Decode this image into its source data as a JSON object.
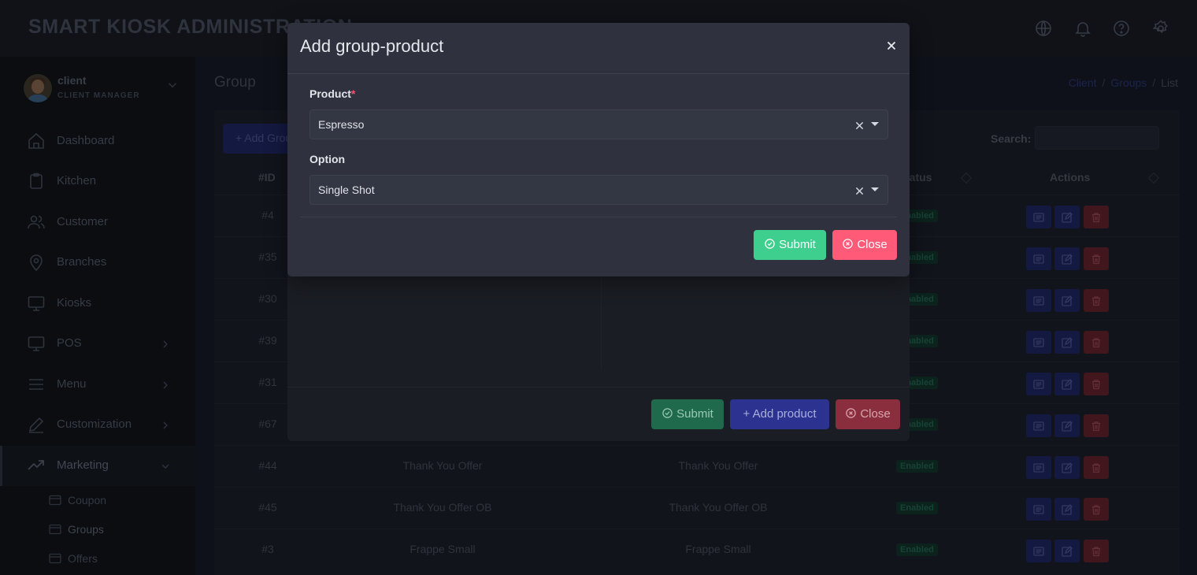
{
  "app": {
    "title": "SMART KIOSK ADMINISTRATION"
  },
  "header_icons": [
    "globe-icon",
    "bell-icon",
    "help-icon",
    "gear-icon"
  ],
  "user": {
    "name": "client",
    "role": "CLIENT MANAGER"
  },
  "sidebar": {
    "items": [
      {
        "label": "Dashboard",
        "icon": "home-icon"
      },
      {
        "label": "Kitchen",
        "icon": "clipboard-icon"
      },
      {
        "label": "Customer",
        "icon": "users-icon"
      },
      {
        "label": "Branches",
        "icon": "map-pin-icon"
      },
      {
        "label": "Kiosks",
        "icon": "monitor-icon"
      },
      {
        "label": "POS",
        "icon": "monitor-icon"
      },
      {
        "label": "Menu",
        "icon": "menu-icon"
      },
      {
        "label": "Customization",
        "icon": "pen-icon"
      },
      {
        "label": "Marketing",
        "icon": "trending-up-icon"
      }
    ],
    "marketing_sub": [
      "Coupon",
      "Groups",
      "Offers"
    ]
  },
  "page": {
    "title": "Group",
    "breadcrumb": [
      "Client",
      "Groups",
      "List"
    ],
    "add_button": "Add Group",
    "search_label": "Search:"
  },
  "table": {
    "columns": [
      "#ID",
      "Status",
      "Actions"
    ],
    "status_column_partial": "tatus",
    "rows": [
      {
        "id": "#4",
        "name": "",
        "name2": "",
        "status": "Enabled"
      },
      {
        "id": "#35",
        "name": "",
        "name2": "",
        "status": "Enabled"
      },
      {
        "id": "#30",
        "name": "",
        "name2": "",
        "status": "Enabled"
      },
      {
        "id": "#39",
        "name": "",
        "name2": "",
        "status": "Enabled"
      },
      {
        "id": "#31",
        "name": "",
        "name2": "",
        "status": "Enabled"
      },
      {
        "id": "#67",
        "name": "",
        "name2": "",
        "status": "Enabled"
      },
      {
        "id": "#44",
        "name": "Thank You Offer",
        "name2": "Thank You Offer",
        "status": "Enabled"
      },
      {
        "id": "#45",
        "name": "Thank You Offer OB",
        "name2": "Thank You Offer OB",
        "status": "Enabled"
      },
      {
        "id": "#3",
        "name": "Frappe Small",
        "name2": "Frappe Small",
        "status": "Enabled"
      }
    ]
  },
  "modal_back": {
    "submit": "Submit",
    "add_product": "Add product",
    "close": "Close"
  },
  "modal": {
    "title": "Add group-product",
    "product_label": "Product",
    "required_mark": "*",
    "product_value": "Espresso",
    "option_label": "Option",
    "option_value": "Single Shot",
    "submit": "Submit",
    "close": "Close"
  },
  "colors": {
    "submit": "#3ecf8e",
    "close": "#ff5a78",
    "primary": "#2f3a9e",
    "danger": "#b23a48"
  }
}
